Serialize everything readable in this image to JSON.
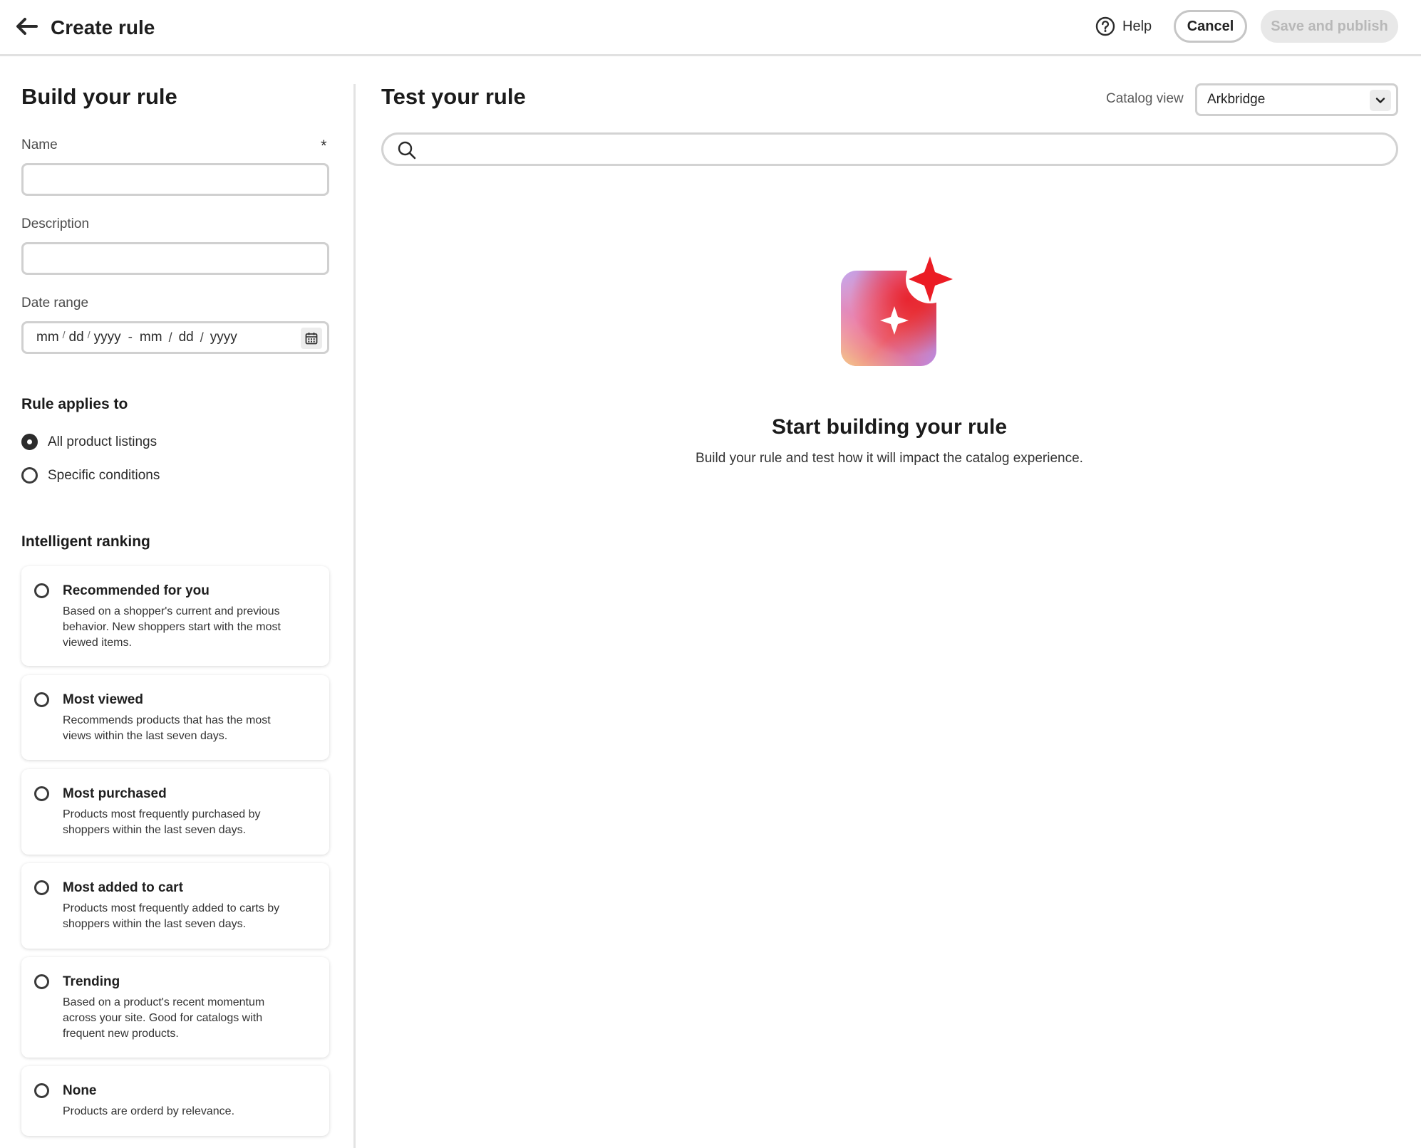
{
  "header": {
    "title": "Create rule",
    "help_label": "Help",
    "cancel_label": "Cancel",
    "save_label": "Save and publish"
  },
  "build": {
    "title": "Build your rule",
    "name_label": "Name",
    "required_mark": "*",
    "description_label": "Description",
    "date_label": "Date range",
    "date": {
      "start_mm": "mm",
      "start_dd": "dd",
      "start_yyyy": "yyyy",
      "sep": "/",
      "dash": "-",
      "end_mm": "mm",
      "end_dd": "dd",
      "end_yyyy": "yyyy"
    },
    "applies_title": "Rule applies to",
    "applies_options": [
      {
        "label": "All product listings",
        "checked": true
      },
      {
        "label": "Specific conditions",
        "checked": false
      }
    ],
    "ranking_title": "Intelligent ranking",
    "ranking_options": [
      {
        "title": "Recommended for you",
        "desc": "Based on a shopper's current and previous behavior. New shoppers start with the most viewed items."
      },
      {
        "title": "Most viewed",
        "desc": "Recommends products that has the most views within the last seven days."
      },
      {
        "title": "Most purchased",
        "desc": "Products most frequently purchased by shoppers within the last seven days."
      },
      {
        "title": "Most added to cart",
        "desc": "Products most frequently added to carts by shoppers within the last seven days."
      },
      {
        "title": "Trending",
        "desc": "Based on a product's recent momentum across your site. Good for catalogs with frequent new products."
      },
      {
        "title": "None",
        "desc": "Products are orderd by relevance."
      }
    ]
  },
  "test": {
    "title": "Test your rule",
    "catalog_label": "Catalog view",
    "catalog_value": "Arkbridge",
    "search_value": "",
    "empty_title": "Start building your rule",
    "empty_desc": "Build your rule and test how it will impact the catalog experience."
  },
  "colors": {
    "accent_red": "#eb1000",
    "disabled_bg": "#e8e8e8",
    "border": "#d0d0d0"
  },
  "icons": [
    "back-arrow-icon",
    "help-icon",
    "calendar-icon",
    "chevron-down-icon",
    "search-icon",
    "sparkle-illustration"
  ]
}
